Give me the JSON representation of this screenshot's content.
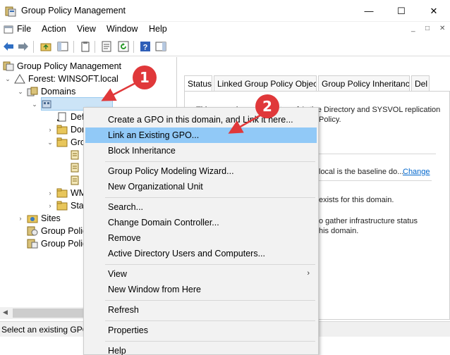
{
  "window": {
    "title": "Group Policy Management",
    "minimize": "—",
    "maximize": "☐",
    "close": "✕"
  },
  "menu": {
    "items": [
      "File",
      "Action",
      "View",
      "Window",
      "Help"
    ],
    "mdi_controls": [
      "_",
      "□",
      "✕"
    ]
  },
  "tree": {
    "root": "Group Policy Management",
    "forest": "Forest: WINSOFT.local",
    "domains": "Domains",
    "children_partial": [
      "Def",
      "Dor",
      "Gro",
      "WM",
      "Sta"
    ],
    "sites": "Sites",
    "gp_modeling": "Group Polic",
    "gp_results": "Group Polic"
  },
  "tabs": [
    "Status",
    "Linked Group Policy Objects",
    "Group Policy Inheritance",
    "Del"
  ],
  "content": {
    "line1a": "This page shows the status of Active Directory and SYSVOL replication",
    "line1b": "Policy.",
    "baseline_text": "local is the baseline do...",
    "change_link": "Change",
    "exists_text": "exists for this domain.",
    "gather_text1": "o gather infrastructure status",
    "gather_text2": "his domain."
  },
  "context_menu": {
    "items": [
      {
        "label": "Create a GPO in this domain, and Link it here..."
      },
      {
        "label": "Link an Existing GPO...",
        "highlighted": true
      },
      {
        "label": "Block Inheritance"
      },
      {
        "label": "Group Policy Modeling Wizard..."
      },
      {
        "label": "New Organizational Unit"
      },
      {
        "label": "Search..."
      },
      {
        "label": "Change Domain Controller..."
      },
      {
        "label": "Remove"
      },
      {
        "label": "Active Directory Users and Computers..."
      },
      {
        "label": "View",
        "submenu": true
      },
      {
        "label": "New Window from Here"
      },
      {
        "label": "Refresh"
      },
      {
        "label": "Properties"
      },
      {
        "label": "Help"
      }
    ],
    "submenu_arrow": "›"
  },
  "status_bar": {
    "text": "Select an existing GPO"
  },
  "annotations": {
    "badge1": "1",
    "badge2": "2",
    "color": "#e0383a"
  },
  "colors": {
    "highlight": "#91c9f7",
    "selection": "#cce4f7",
    "link": "#0066cc"
  }
}
